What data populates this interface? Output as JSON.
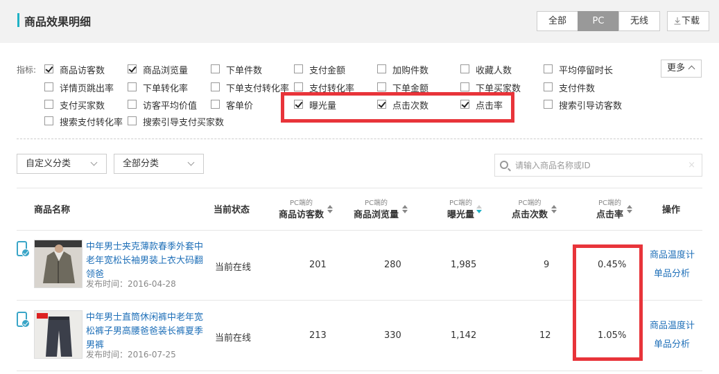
{
  "header": {
    "title": "商品效果明细",
    "segments": [
      "全部",
      "PC",
      "无线"
    ],
    "download_label": "下载"
  },
  "metrics": {
    "label": "指标:",
    "more_label": "更多",
    "items": [
      {
        "label": "商品访客数",
        "checked": true
      },
      {
        "label": "商品浏览量",
        "checked": true
      },
      {
        "label": "下单件数",
        "checked": false
      },
      {
        "label": "支付金额",
        "checked": false
      },
      {
        "label": "加购件数",
        "checked": false
      },
      {
        "label": "收藏人数",
        "checked": false
      },
      {
        "label": "平均停留时长",
        "checked": false
      },
      {
        "label": "详情页跳出率",
        "checked": false
      },
      {
        "label": "下单转化率",
        "checked": false
      },
      {
        "label": "下单支付转化率",
        "checked": false
      },
      {
        "label": "支付转化率",
        "checked": false
      },
      {
        "label": "下单金额",
        "checked": false
      },
      {
        "label": "下单买家数",
        "checked": false
      },
      {
        "label": "支付件数",
        "checked": false
      },
      {
        "label": "支付买家数",
        "checked": false
      },
      {
        "label": "访客平均价值",
        "checked": false
      },
      {
        "label": "客单价",
        "checked": false
      },
      {
        "label": "曝光量",
        "checked": true
      },
      {
        "label": "点击次数",
        "checked": true
      },
      {
        "label": "点击率",
        "checked": true
      },
      {
        "label": "搜索引导访客数",
        "checked": false
      },
      {
        "label": "搜索支付转化率",
        "checked": false
      },
      {
        "label": "搜索引导支付买家数",
        "checked": false
      }
    ]
  },
  "filters": {
    "category1": "自定义分类",
    "category2": "全部分类",
    "search_placeholder": "请输入商品名称或ID",
    "clear_icon": "×"
  },
  "table": {
    "col_name": "商品名称",
    "col_status": "当前状态",
    "col_ops": "操作",
    "sub_prefix": "PC端的",
    "metric_cols": [
      "商品访客数",
      "商品浏览量",
      "曝光量",
      "点击次数",
      "点击率"
    ],
    "rows": [
      {
        "name": "中年男士夹克薄款春季外套中老年宽松长袖男装上衣大码翻领爸",
        "date": "发布时间：2016-04-28",
        "status": "当前在线",
        "visitors": "201",
        "views": "280",
        "exposure": "1,985",
        "clicks": "9",
        "ctr": "0.45%",
        "op1": "商品温度计",
        "op2": "单品分析"
      },
      {
        "name": "中年男士直筒休闲裤中老年宽松裤子男高腰爸爸装长裤夏季男裤",
        "date": "发布时间：2016-07-25",
        "status": "当前在线",
        "visitors": "213",
        "views": "330",
        "exposure": "1,142",
        "clicks": "12",
        "ctr": "1.05%",
        "op1": "商品温度计",
        "op2": "单品分析"
      }
    ]
  },
  "colors": {
    "accent": "#1fb2c5",
    "highlight": "#e8343a",
    "link": "#1e6fb8"
  }
}
